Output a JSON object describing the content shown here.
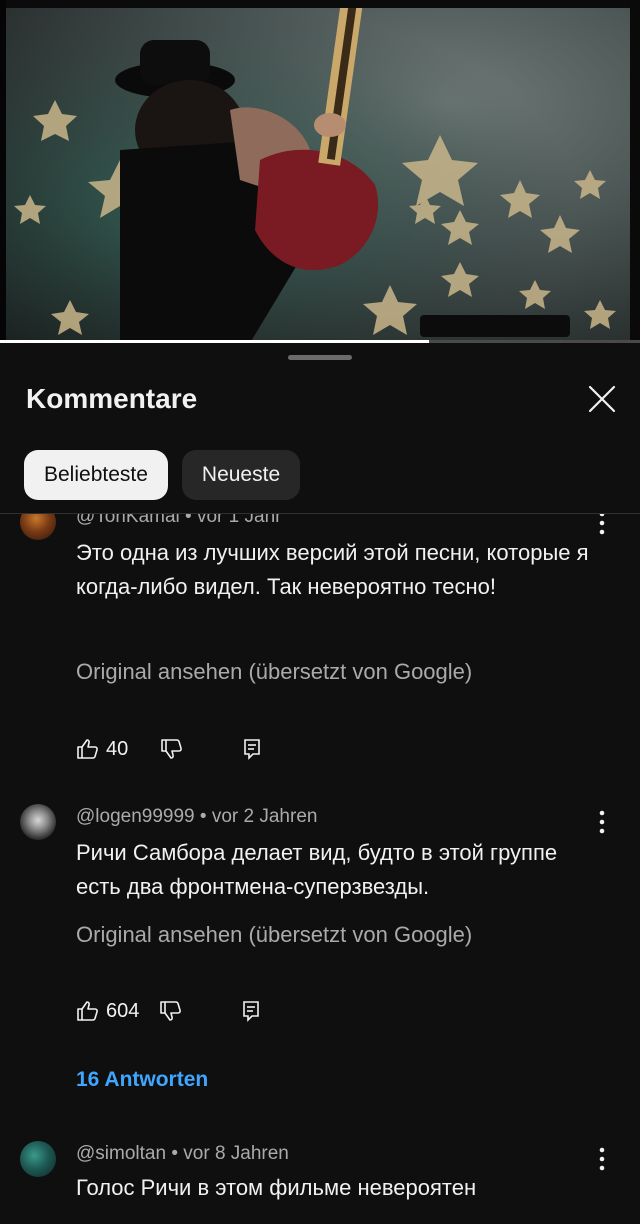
{
  "video": {
    "progress_fraction": 0.67
  },
  "sheet": {
    "title": "Kommentare",
    "close_icon": "close-icon",
    "chips": [
      {
        "label": "Beliebteste",
        "selected": true
      },
      {
        "label": "Neueste",
        "selected": false
      }
    ]
  },
  "comments": [
    {
      "author": "@ToriKamal",
      "age": "vor 1 Jahr",
      "text": "Это одна из лучших версий этой песни, которые я когда-либо видел. Так невероятно тесно!",
      "original_link": "Original ansehen (übersetzt von Google)",
      "likes": "40",
      "replies": ""
    },
    {
      "author": "@logen99999",
      "age": "vor 2 Jahren",
      "text": "Ричи Самбора делает вид, будто в этой группе есть два фронтмена-суперзвезды.",
      "original_link": "Original ansehen (übersetzt von Google)",
      "likes": "604",
      "replies": "16 Antworten"
    },
    {
      "author": "@simoltan",
      "age": "vor 8 Jahren",
      "text": "Голос Ричи в этом фильме невероятен",
      "original_link": "",
      "likes": "",
      "replies": ""
    }
  ],
  "separator": "•",
  "colors": {
    "background": "#0f0f0f",
    "link": "#3ea6ff",
    "muted": "#aaaaaa",
    "chip_active": "#f1f1f1",
    "chip_inactive": "#272727"
  },
  "icons": {
    "like": "thumb-up-icon",
    "dislike": "thumb-down-icon",
    "reply": "reply-icon",
    "more": "kebab-menu-icon"
  }
}
